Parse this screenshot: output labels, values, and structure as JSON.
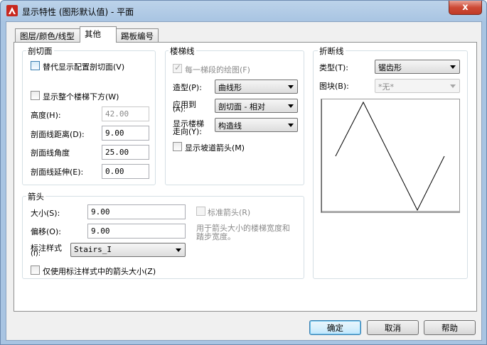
{
  "window": {
    "title": "显示特性 (图形默认值) - 平面",
    "close_glyph": "x",
    "accent_color": "#c03a26"
  },
  "tabs": [
    {
      "label": "图层/颜色/线型",
      "active": false
    },
    {
      "label": "其他",
      "active": true
    },
    {
      "label": "踢板编号",
      "active": false
    }
  ],
  "section_cut": {
    "title": "剖切面",
    "override_label": "替代显示配置剖切面(V)",
    "show_below_label": "显示整个楼梯下方(W)",
    "height_label": "高度(H):",
    "height_value": "42.00",
    "distance_label": "剖面线距离(D):",
    "distance_value": "9.00",
    "angle_label": "剖面线角度",
    "angle_value": "25.00",
    "extension_label": "剖面线延伸(E):",
    "extension_value": "0.00"
  },
  "stair_line": {
    "title": "楼梯线",
    "each_flight_label": "每一梯段的绘图(F)",
    "shape_label": "造型(P):",
    "shape_value": "曲线形",
    "apply_label_1": "应用到",
    "apply_label_2": "(A):",
    "apply_value": "剖切面 - 相对",
    "direction_label_1": "显示楼梯",
    "direction_label_2": "走向(Y):",
    "direction_value": "构造线",
    "ramp_arrow_label": "显示坡道箭头(M)"
  },
  "break_line": {
    "title": "折断线",
    "type_label": "类型(T):",
    "type_value": "锯齿形",
    "block_label": "图块(B):",
    "block_value": "*无*"
  },
  "arrow": {
    "title": "箭头",
    "size_label": "大小(S):",
    "size_value": "9.00",
    "offset_label": "偏移(O):",
    "offset_value": "9.00",
    "dim_style_label_1": "标注样式",
    "dim_style_label_2": "(I):",
    "dim_style_value": "Stairs_I",
    "standard_arrow_label": "标准箭头(R)",
    "hint_text": "用于箭头大小的楼梯宽度和踏步宽度。",
    "use_dim_style_label": "仅使用标注样式中的箭头大小(Z)"
  },
  "buttons": {
    "ok": "确定",
    "cancel": "取消",
    "help": "帮助"
  }
}
